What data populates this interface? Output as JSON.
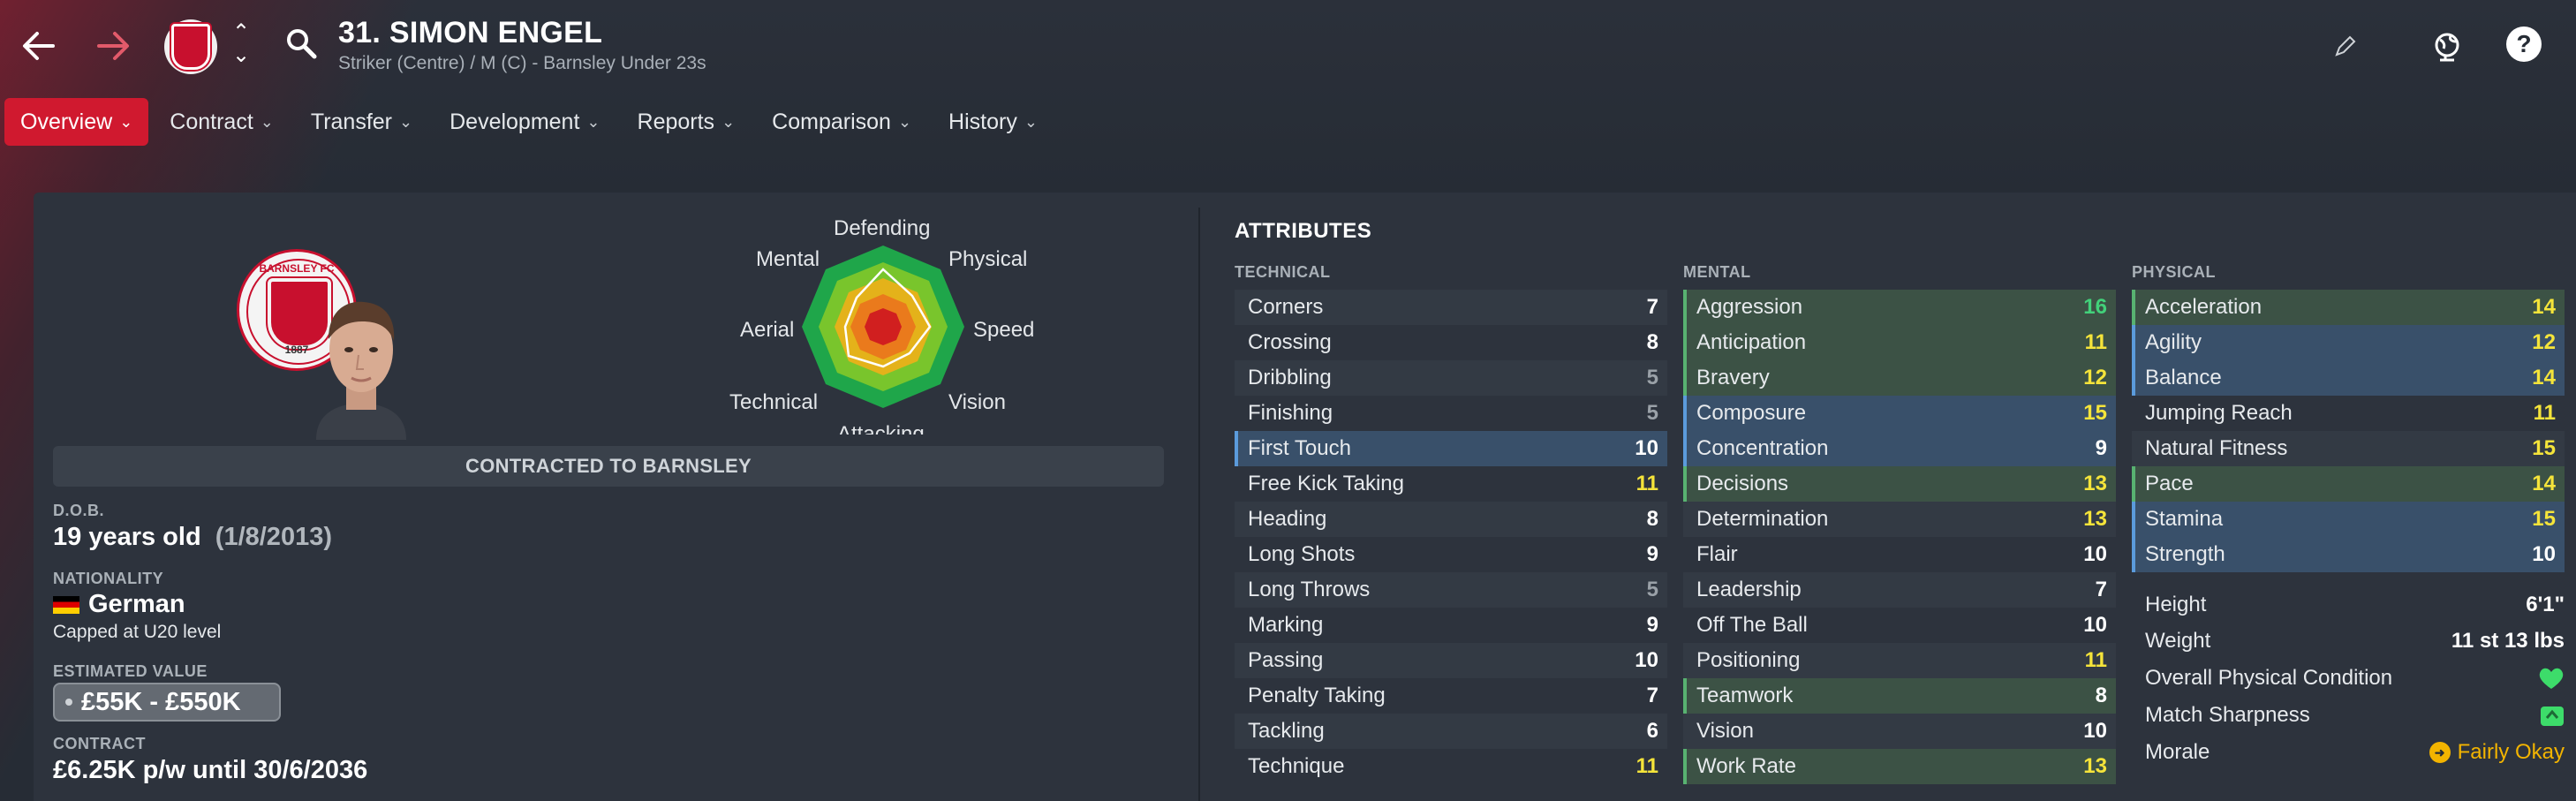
{
  "header": {
    "title": "31. SIMON ENGEL",
    "subtitle": "Striker (Centre) / M (C) - Barnsley Under 23s",
    "back_icon": "arrow-left-icon",
    "forward_icon": "arrow-right-icon"
  },
  "tabs": [
    {
      "label": "Overview",
      "active": true
    },
    {
      "label": "Contract"
    },
    {
      "label": "Transfer"
    },
    {
      "label": "Development"
    },
    {
      "label": "Reports"
    },
    {
      "label": "Comparison"
    },
    {
      "label": "History"
    }
  ],
  "overview": {
    "crest_name": "BARNSLEY FC",
    "crest_year": "1887",
    "contracted_banner": "CONTRACTED TO BARNSLEY",
    "dob_label": "D.O.B.",
    "age": "19 years old",
    "dob": "(1/8/2013)",
    "nationality_label": "NATIONALITY",
    "nationality": "German",
    "caps": "Capped at U20 level",
    "value_label": "ESTIMATED VALUE",
    "value": "£55K - £550K",
    "contract_label": "CONTRACT",
    "contract": "£6.25K p/w until 30/6/2036"
  },
  "radar": {
    "labels": {
      "top": "Defending",
      "top_right": "Physical",
      "right": "Speed",
      "bottom_right": "Vision",
      "bottom": "Attacking",
      "bottom_left": "Technical",
      "left": "Aerial",
      "top_left": "Mental"
    }
  },
  "attributes": {
    "title": "ATTRIBUTES",
    "technical_label": "TECHNICAL",
    "mental_label": "MENTAL",
    "physical_label": "PHYSICAL",
    "technical": [
      {
        "name": "Corners",
        "value": "7"
      },
      {
        "name": "Crossing",
        "value": "8"
      },
      {
        "name": "Dribbling",
        "value": "5"
      },
      {
        "name": "Finishing",
        "value": "5"
      },
      {
        "name": "First Touch",
        "value": "10"
      },
      {
        "name": "Free Kick Taking",
        "value": "11"
      },
      {
        "name": "Heading",
        "value": "8"
      },
      {
        "name": "Long Shots",
        "value": "9"
      },
      {
        "name": "Long Throws",
        "value": "5"
      },
      {
        "name": "Marking",
        "value": "9"
      },
      {
        "name": "Passing",
        "value": "10"
      },
      {
        "name": "Penalty Taking",
        "value": "7"
      },
      {
        "name": "Tackling",
        "value": "6"
      },
      {
        "name": "Technique",
        "value": "11"
      }
    ],
    "mental": [
      {
        "name": "Aggression",
        "value": "16"
      },
      {
        "name": "Anticipation",
        "value": "11"
      },
      {
        "name": "Bravery",
        "value": "12"
      },
      {
        "name": "Composure",
        "value": "15"
      },
      {
        "name": "Concentration",
        "value": "9"
      },
      {
        "name": "Decisions",
        "value": "13"
      },
      {
        "name": "Determination",
        "value": "13"
      },
      {
        "name": "Flair",
        "value": "10"
      },
      {
        "name": "Leadership",
        "value": "7"
      },
      {
        "name": "Off The Ball",
        "value": "10"
      },
      {
        "name": "Positioning",
        "value": "11"
      },
      {
        "name": "Teamwork",
        "value": "8"
      },
      {
        "name": "Vision",
        "value": "10"
      },
      {
        "name": "Work Rate",
        "value": "13"
      }
    ],
    "physical": [
      {
        "name": "Acceleration",
        "value": "14"
      },
      {
        "name": "Agility",
        "value": "12"
      },
      {
        "name": "Balance",
        "value": "14"
      },
      {
        "name": "Jumping Reach",
        "value": "11"
      },
      {
        "name": "Natural Fitness",
        "value": "15"
      },
      {
        "name": "Pace",
        "value": "14"
      },
      {
        "name": "Stamina",
        "value": "15"
      },
      {
        "name": "Strength",
        "value": "10"
      }
    ]
  },
  "physical_info": {
    "height_label": "Height",
    "height": "6'1\"",
    "weight_label": "Weight",
    "weight": "11 st 13 lbs",
    "condition_label": "Overall Physical Condition",
    "sharpness_label": "Match Sharpness",
    "morale_label": "Morale",
    "morale": "Fairly Okay"
  },
  "colors": {
    "accent": "#d0192f",
    "attr_high": "#42d17a",
    "attr_good": "#f5e43a",
    "attr_low": "#9aa1a8"
  }
}
